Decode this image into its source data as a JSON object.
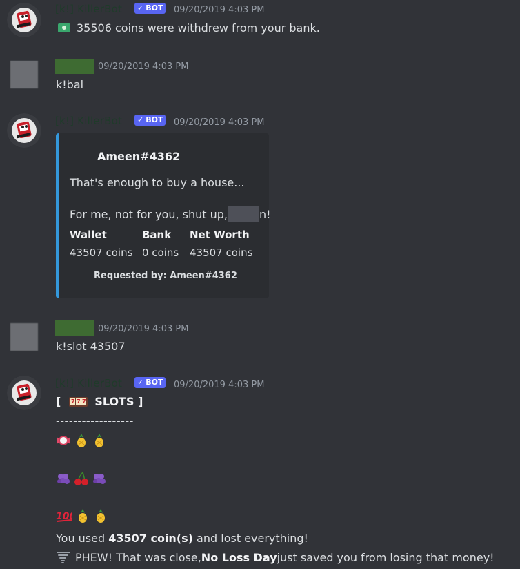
{
  "messages": {
    "m1": {
      "author": "[k!] KillerBot",
      "badge": "BOT",
      "time": "09/20/2019 4:03 PM",
      "text": "35506 coins were withdrew from your bank."
    },
    "m2": {
      "time": "09/20/2019 4:03 PM",
      "text": "k!bal"
    },
    "m3": {
      "author": "[k!] KillerBot",
      "badge": "BOT",
      "time": "09/20/2019 4:03 PM",
      "embed": {
        "title": "Ameen#4362",
        "line1": "That's enough to buy a house...",
        "line2_pre": "For me, not for you, shut up, ",
        "line2_post": "n!",
        "fields": [
          {
            "name": "Wallet",
            "value": "43507 coins"
          },
          {
            "name": "Bank",
            "value": "0 coins"
          },
          {
            "name": "Net Worth",
            "value": "43507 coins"
          }
        ],
        "footer": "Requested by: Ameen#4362",
        "accent": "#3498db"
      }
    },
    "m4": {
      "time": "09/20/2019 4:03 PM",
      "text": "k!slot 43507"
    },
    "m5": {
      "author": "[k!] KillerBot",
      "badge": "BOT",
      "time": "09/20/2019 4:03 PM",
      "header_open": "[",
      "header_title": "SLOTS ]",
      "divider": "------------------",
      "row1": [
        "candy-icon",
        "pineapple-icon",
        "pineapple-icon"
      ],
      "row2": [
        "grapes-icon",
        "cherries-icon",
        "grapes-icon"
      ],
      "row3": [
        "hundred-icon",
        "pineapple-icon",
        "pineapple-icon"
      ],
      "used_pre": "You used ",
      "used_amount": "43507 coin(s)",
      "used_post": " and lost everything!",
      "phew_pre": "PHEW! That was close, ",
      "phew_bold": "No Loss Day",
      "phew_post": " just saved you from losing that money!"
    }
  },
  "colors": {
    "background": "#313338",
    "bot_badge": "#5865f2",
    "embed_bg": "#2b2d31",
    "timestamp": "#949ba4"
  }
}
